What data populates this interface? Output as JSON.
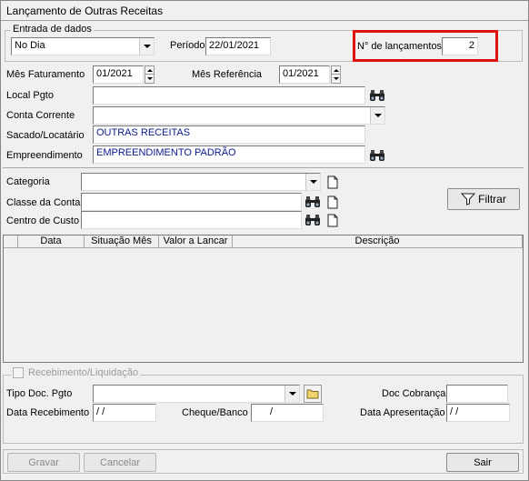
{
  "window": {
    "title": "Lançamento de Outras Receitas"
  },
  "entrada": {
    "legend": "Entrada de dados",
    "mode_value": "No Dia",
    "periodo_label": "Período",
    "periodo_value": "22/01/2021",
    "nlanc_label": "N° de lançamentos",
    "nlanc_value": "2"
  },
  "form": {
    "mes_fat_label": "Mês Faturamento",
    "mes_fat_value": "01/2021",
    "mes_ref_label": "Mês Referência",
    "mes_ref_value": "01/2021",
    "local_pgto_label": "Local Pgto",
    "local_pgto_value": "",
    "conta_corrente_label": "Conta Corrente",
    "conta_corrente_value": "",
    "sacado_label": "Sacado/Locatário",
    "sacado_value": "OUTRAS RECEITAS",
    "empreendimento_label": "Empreendimento",
    "empreendimento_value": "EMPREENDIMENTO PADRÃO"
  },
  "filtros": {
    "categoria_label": "Categoria",
    "categoria_value": "",
    "classe_label": "Classe da Conta",
    "classe_value": "",
    "centro_label": "Centro de Custo",
    "centro_value": "",
    "filtrar_label": "Filtrar"
  },
  "grid": {
    "columns": [
      "Data",
      "Situação Mês",
      "Valor a Lancar",
      "Descrição"
    ]
  },
  "recebimento": {
    "legend": "Recebimento/Liquidação",
    "tipo_doc_label": "Tipo Doc. Pgto",
    "tipo_doc_value": "",
    "doc_cobranca_label": "Doc Cobrança",
    "doc_cobranca_value": "",
    "data_receb_label": "Data Recebimento",
    "data_receb_value": " /  /",
    "cheque_label": "Cheque/Banco",
    "cheque_value": "/",
    "data_apres_label": "Data Apresentação",
    "data_apres_value": " /  /"
  },
  "footer": {
    "gravar_label": "Gravar",
    "cancelar_label": "Cancelar",
    "sair_label": "Sair"
  },
  "icons": {
    "binoculars": "binoculars-icon",
    "new_document": "new-document-icon",
    "folder": "folder-icon",
    "filter": "filter-icon",
    "dropdown": "chevron-down-icon"
  },
  "colors": {
    "highlight": "#e01010",
    "value_text": "#0a1a8f"
  }
}
